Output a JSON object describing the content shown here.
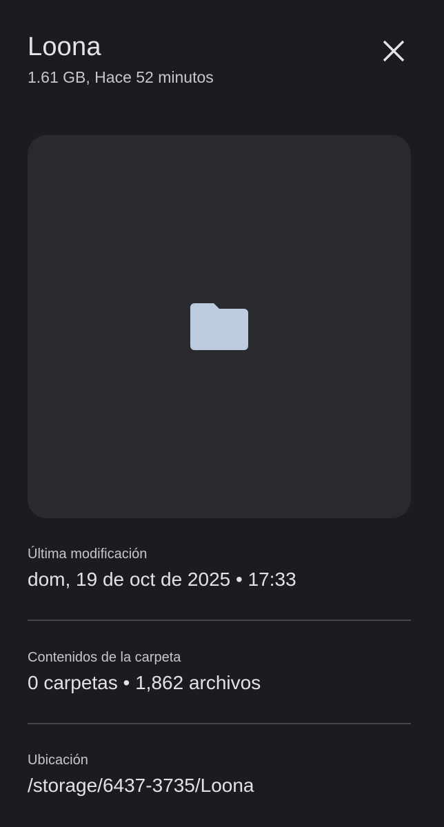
{
  "header": {
    "title": "Loona",
    "subtitle": "1.61 GB, Hace 52 minutos"
  },
  "icons": {
    "close": "close-icon",
    "preview": "folder-icon"
  },
  "colors": {
    "background": "#1b1c20",
    "preview_background": "#282a2f",
    "folder": "#bccbde",
    "divider": "#45474d"
  },
  "details": {
    "modified": {
      "label": "Última modificación",
      "value": "dom, 19 de oct de 2025 • 17:33"
    },
    "contents": {
      "label": "Contenidos de la carpeta",
      "value": "0 carpetas • 1,862 archivos"
    },
    "location": {
      "label": "Ubicación",
      "value": "/storage/6437-3735/Loona"
    }
  }
}
